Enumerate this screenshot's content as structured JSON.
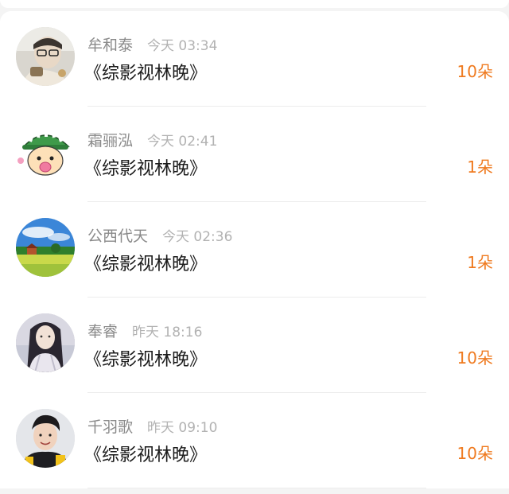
{
  "gift_list": {
    "items": [
      {
        "name": "牟和泰",
        "time": "今天 03:34",
        "message": "《综影视林晚》",
        "amount": "10朵",
        "avatar": "avatar-photo-person-glasses"
      },
      {
        "name": "霜骊泓",
        "time": "今天 02:41",
        "message": "《综影视林晚》",
        "amount": "1朵",
        "avatar": "avatar-cartoon-green-hat"
      },
      {
        "name": "公西代天",
        "time": "今天 02:36",
        "message": "《综影视林晚》",
        "amount": "1朵",
        "avatar": "avatar-landscape-house"
      },
      {
        "name": "奉睿",
        "time": "昨天 18:16",
        "message": "《综影视林晚》",
        "amount": "10朵",
        "avatar": "avatar-portrait-woman"
      },
      {
        "name": "千羽歌",
        "time": "昨天 09:10",
        "message": "《综影视林晚》",
        "amount": "10朵",
        "avatar": "avatar-portrait-young-man"
      }
    ]
  },
  "colors": {
    "amount": "#ef7a1f",
    "name": "#8a8a8a",
    "time": "#b2b2b2",
    "message": "#1a1a1a",
    "background": "#f4f4f4"
  }
}
